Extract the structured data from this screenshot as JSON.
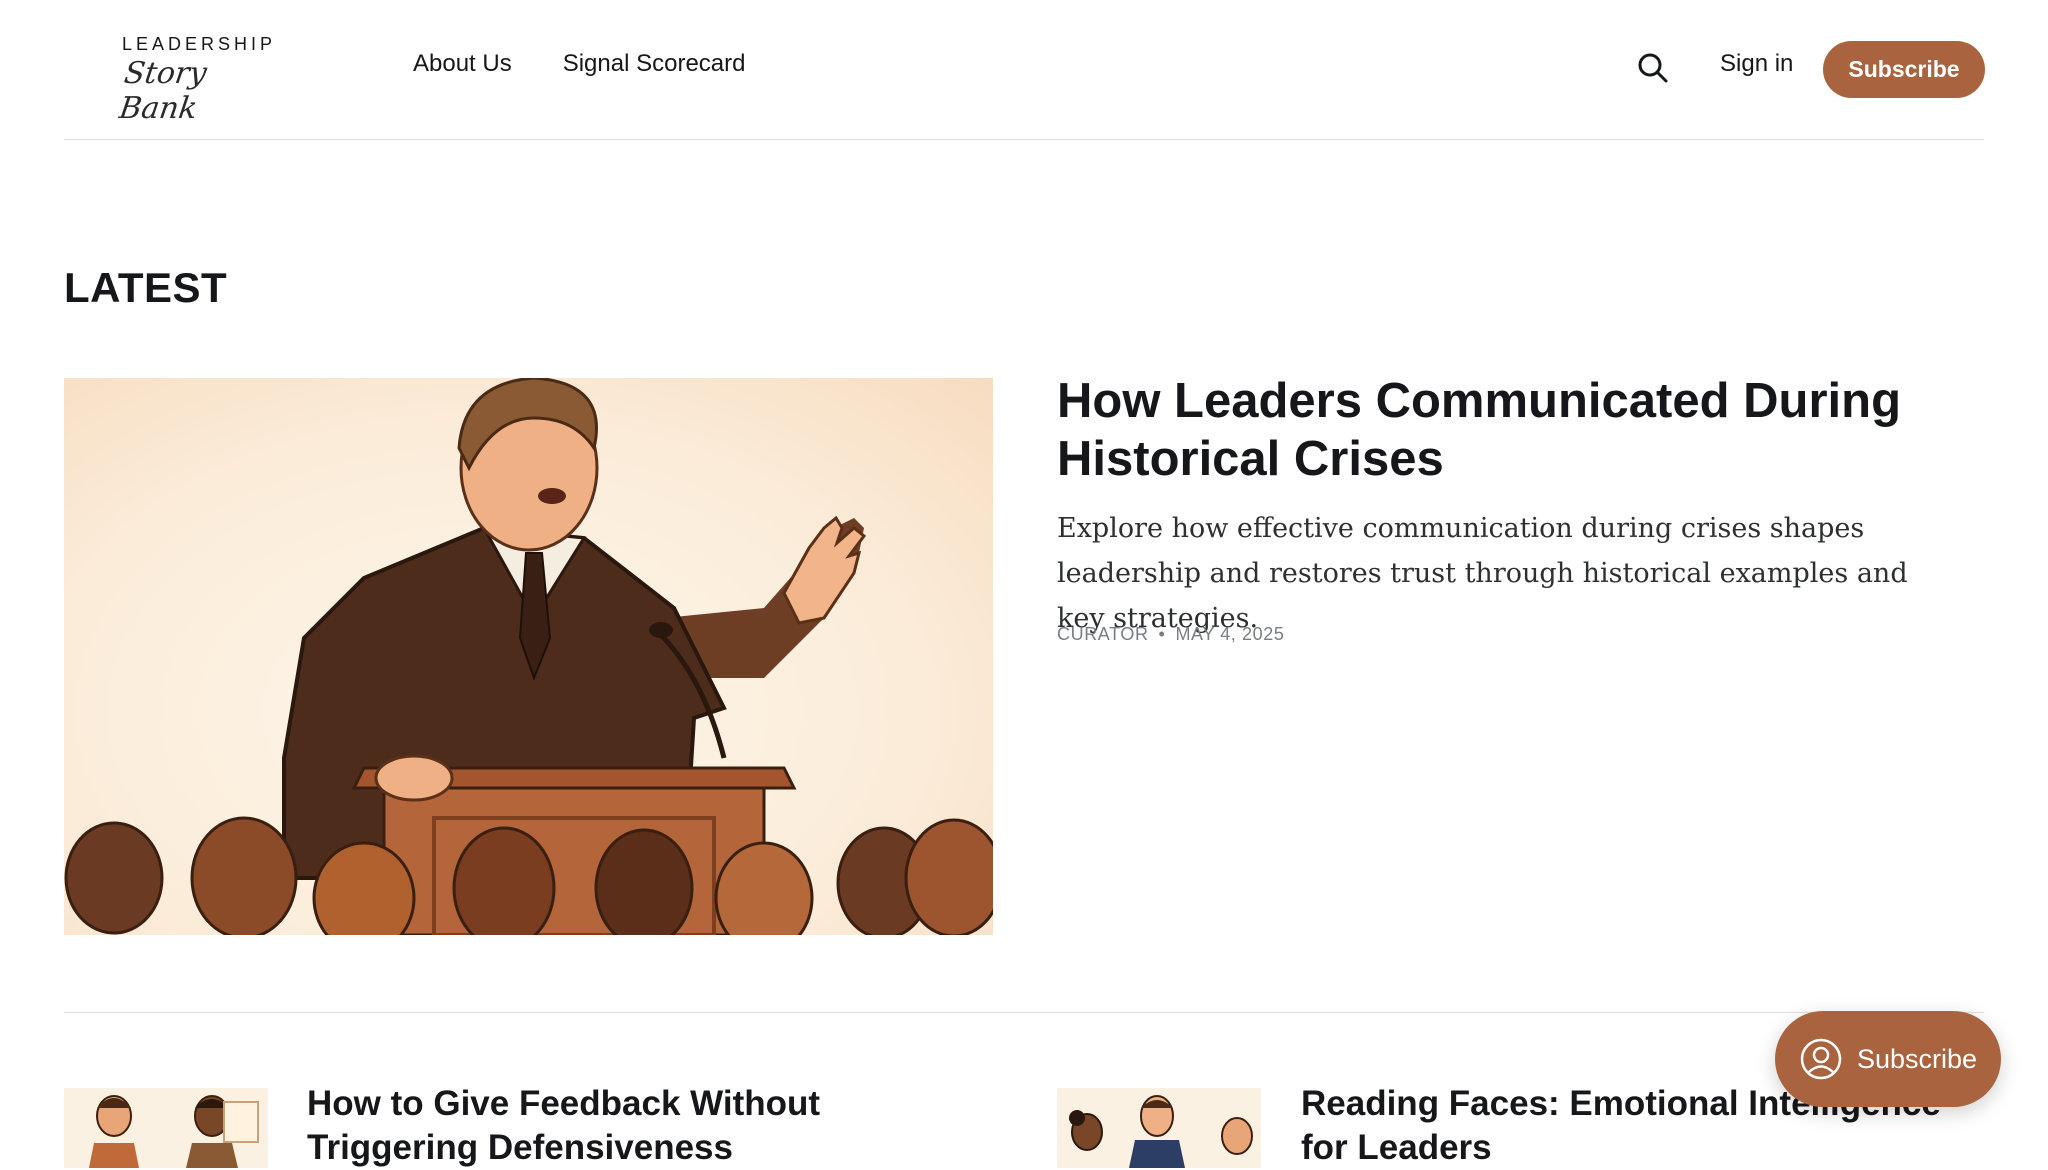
{
  "header": {
    "logo_top": "LEADERSHIP",
    "logo_script": "Story Bank",
    "nav": [
      "About Us",
      "Signal Scorecard"
    ],
    "search_icon": "search-icon",
    "signin_label": "Sign in",
    "subscribe_label": "Subscribe"
  },
  "section_title": "LATEST",
  "featured": {
    "title": "How Leaders Communicated During Historical Crises",
    "excerpt": "Explore how effective communication during crises shapes leadership and restores trust through historical examples and key strategies.",
    "author": "CURATOR",
    "separator": "•",
    "date": "MAY 4, 2025"
  },
  "cards": [
    {
      "title": "How to Give Feedback Without Triggering Defensiveness"
    },
    {
      "title": "Reading Faces: Emotional Intelligence for Leaders"
    }
  ],
  "floating_subscribe": {
    "label": "Subscribe",
    "icon": "user-circle-icon"
  },
  "colors": {
    "accent": "#a9643f",
    "text": "#15171a",
    "muted": "#7a7d82",
    "divider": "#dddddd"
  }
}
